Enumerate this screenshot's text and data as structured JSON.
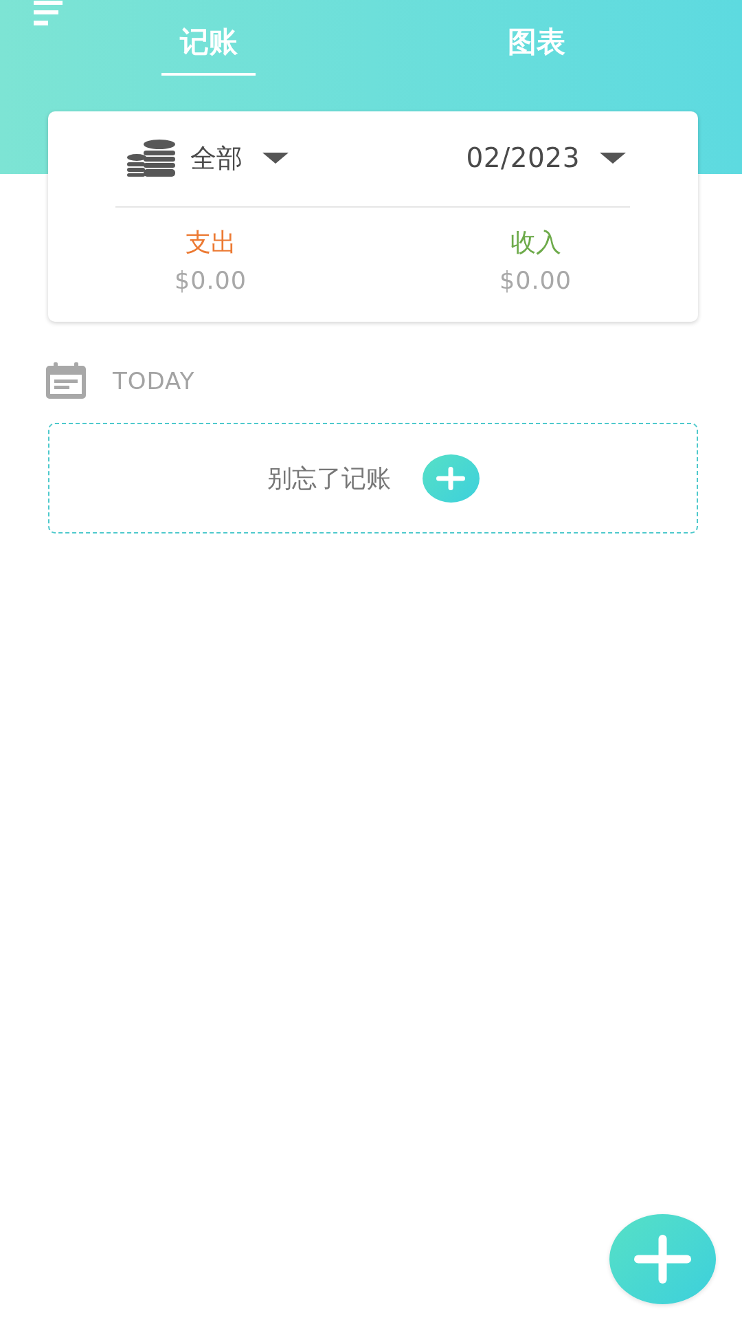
{
  "header": {
    "tabs": [
      {
        "label": "记账",
        "selected": true
      },
      {
        "label": "图表",
        "selected": false
      }
    ]
  },
  "summary_card": {
    "account_filter": "全部",
    "month": "02/2023",
    "totals": [
      {
        "label": "支出",
        "amount": "$0.00",
        "color": "#ec7a33"
      },
      {
        "label": "收入",
        "amount": "$0.00",
        "color": "#6daa4a"
      }
    ]
  },
  "today_section": {
    "title": "TODAY",
    "empty_prompt": "别忘了记账"
  }
}
